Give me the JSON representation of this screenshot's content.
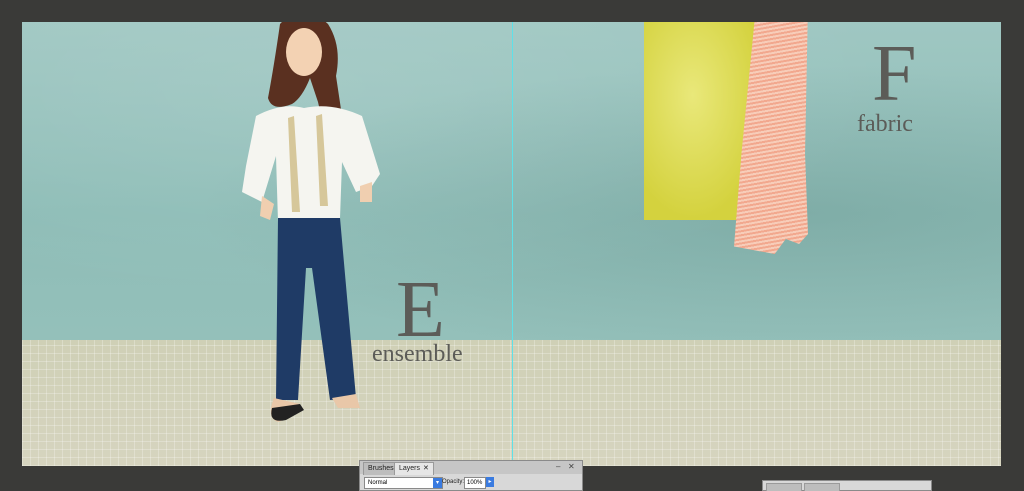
{
  "artwork": {
    "left_letter": "E",
    "left_word": "ensemble",
    "right_letter": "F",
    "right_word": "fabric"
  },
  "colors": {
    "wall": "#8ebdb7",
    "floor": "#d6d4bf",
    "guide": "#5fe0e8",
    "text": "#5c5c58",
    "accent_blue": "#3a7be0"
  },
  "layers_panel": {
    "tabs": [
      {
        "label": "Brushes"
      },
      {
        "label": "Layers"
      }
    ],
    "tab_close_icon": "close-icon",
    "blend_mode": "Normal",
    "opacity_label": "Opacity:",
    "opacity_value": "100%"
  }
}
